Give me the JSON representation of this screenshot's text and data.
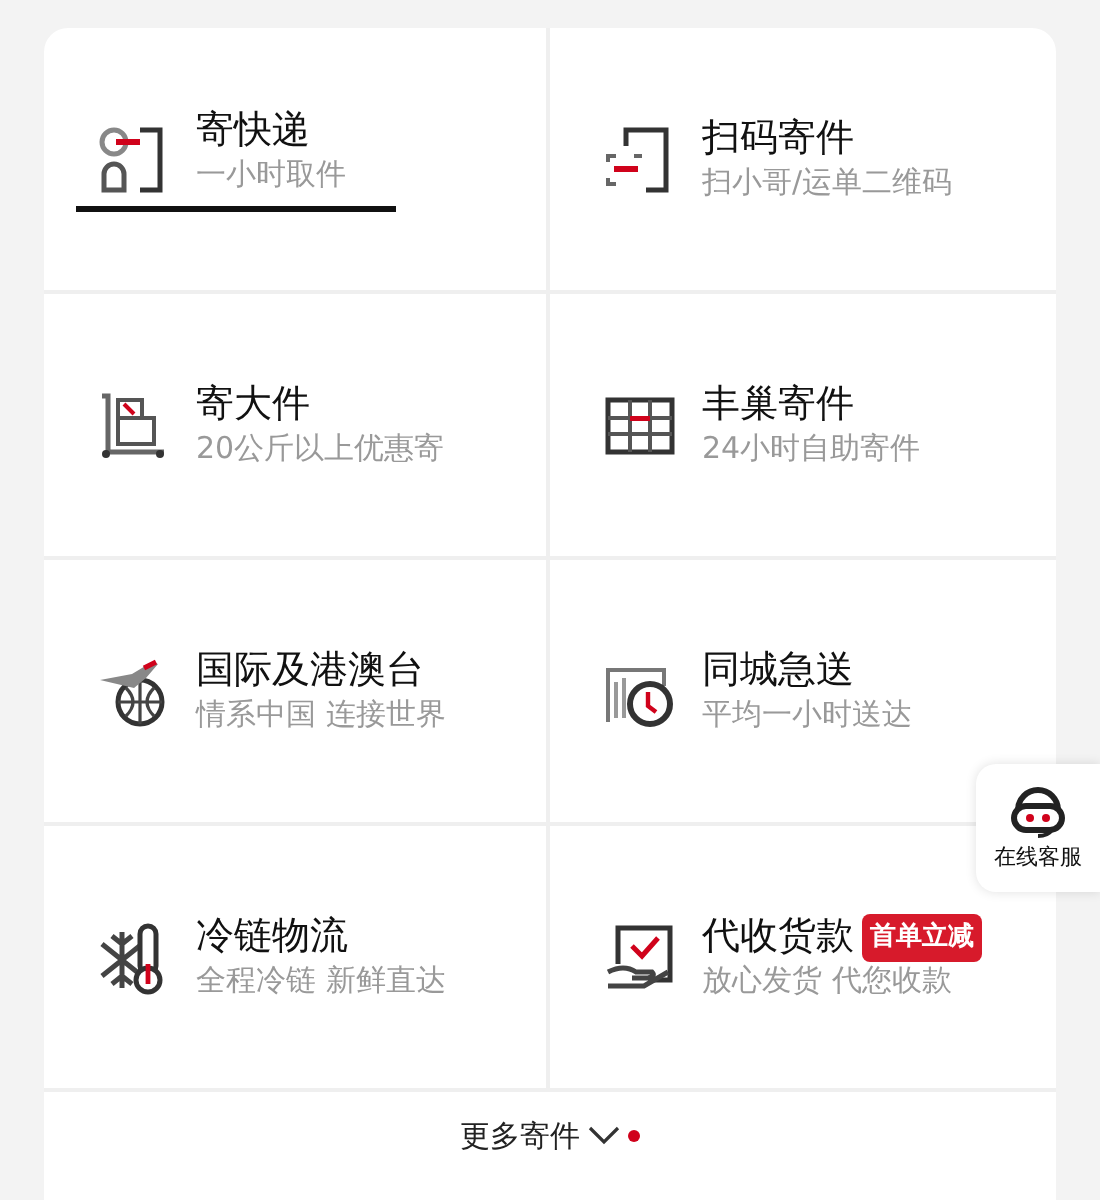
{
  "services": [
    {
      "kind": "express",
      "title": "寄快递",
      "subtitle": "一小时取件",
      "selected": true
    },
    {
      "kind": "scan",
      "title": "扫码寄件",
      "subtitle": "扫小哥/运单二维码",
      "selected": false
    },
    {
      "kind": "bulky",
      "title": "寄大件",
      "subtitle": "20公斤以上优惠寄",
      "selected": false
    },
    {
      "kind": "locker",
      "title": "丰巢寄件",
      "subtitle": "24小时自助寄件",
      "selected": false
    },
    {
      "kind": "international",
      "title": "国际及港澳台",
      "subtitle": "情系中国 连接世界",
      "selected": false
    },
    {
      "kind": "citywide",
      "title": "同城急送",
      "subtitle": "平均一小时送达",
      "selected": false
    },
    {
      "kind": "cold",
      "title": "冷链物流",
      "subtitle": "全程冷链 新鲜直达",
      "selected": false
    },
    {
      "kind": "cod",
      "title": "代收货款",
      "subtitle": "放心发货 代您收款",
      "selected": false,
      "badge": "首单立减"
    }
  ],
  "more": {
    "label": "更多寄件",
    "unread_dot": true
  },
  "support": {
    "label": "在线客服"
  }
}
